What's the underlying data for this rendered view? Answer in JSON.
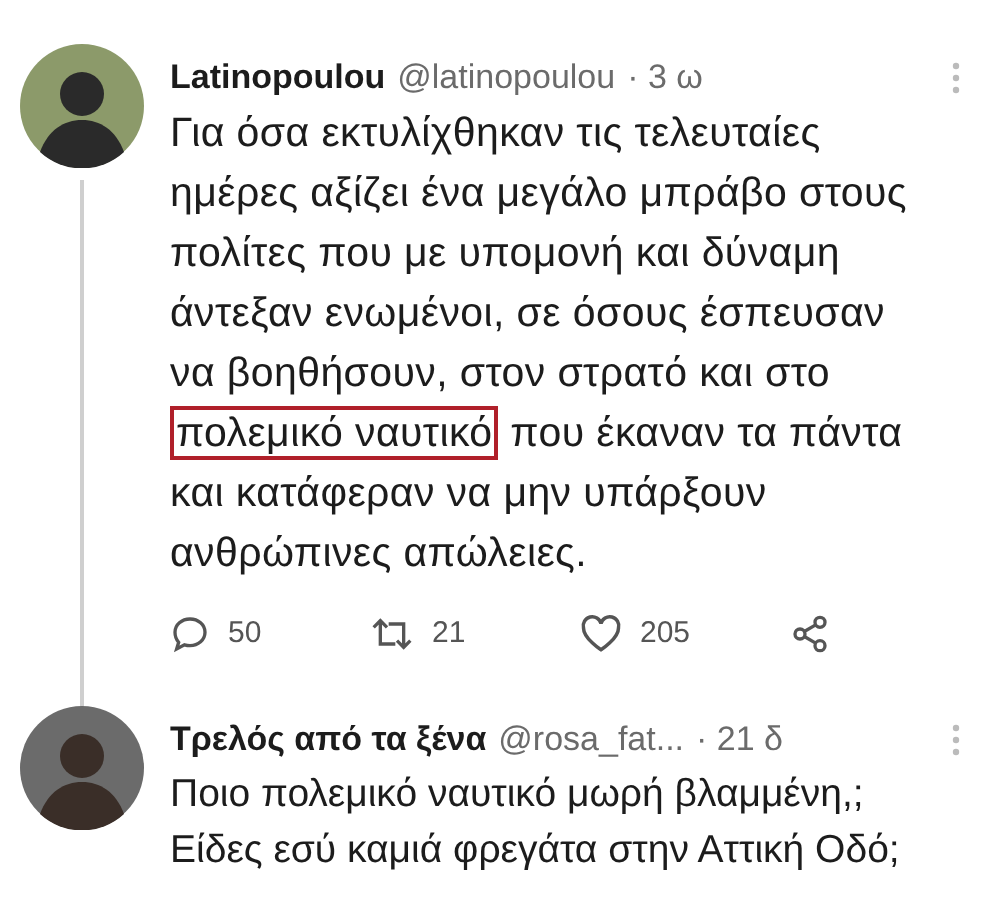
{
  "tweets": [
    {
      "name": "Latinopoulou",
      "handle": "@latinopoulou",
      "time": "· 3 ω",
      "text_before": "Για όσα εκτυλίχθηκαν τις τελευταίες ημέρες αξίζει ένα μεγάλο μπράβο στους πολίτες που με υπομονή και δύναμη άντεξαν ενωμένοι, σε όσους έσπευσαν να βοηθήσουν, στον στρατό και στο",
      "highlight": "πολεμικό ναυτικό",
      "text_after": "που έκαναν τα πάντα και κατάφεραν να μην υπάρξουν ανθρώπινες απώλειες.",
      "thread_line": true,
      "actions": [
        {
          "kind": "reply",
          "count": "50"
        },
        {
          "kind": "retweet",
          "count": "21"
        },
        {
          "kind": "like",
          "count": "205"
        },
        {
          "kind": "share"
        }
      ]
    },
    {
      "name": "Τρελός από τα ξένα",
      "handle": "@rosa_fat...",
      "time": "· 21 δ",
      "text_before": "Ποιο πολεμικό ναυτικό μωρή βλαμμένη,; Είδες εσύ καμιά φρεγάτα στην Αττική Οδό;",
      "thread_line": false
    }
  ]
}
